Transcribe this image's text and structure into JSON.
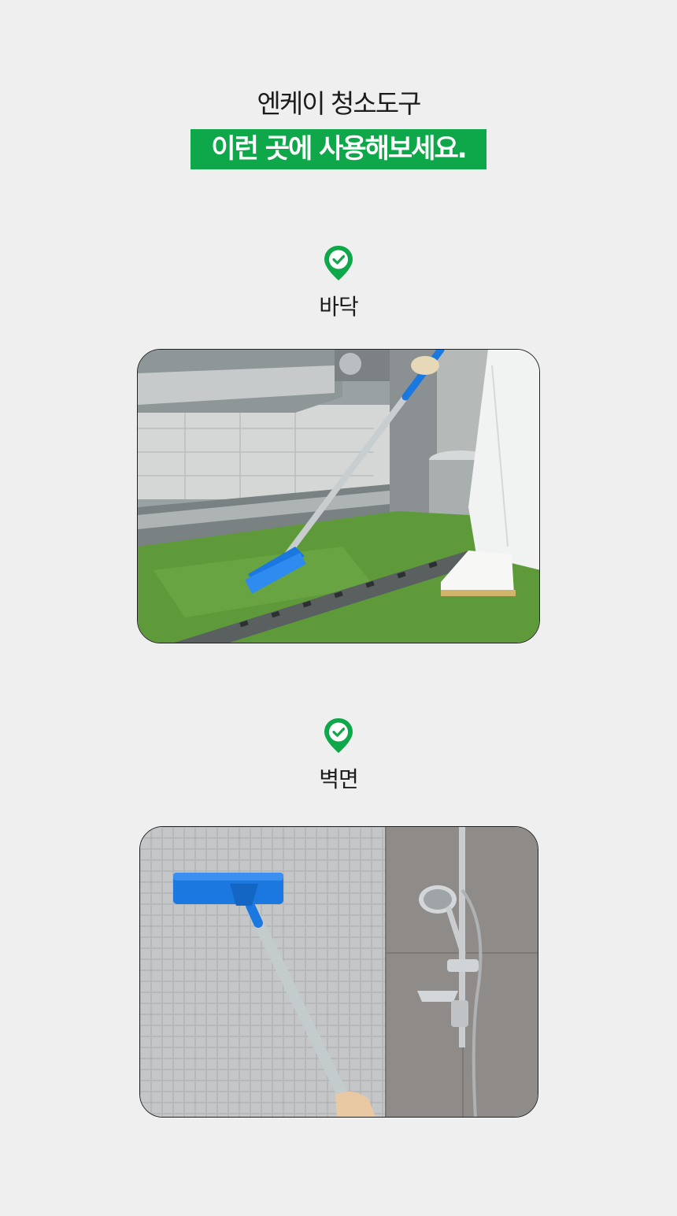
{
  "header": {
    "subtitle": "엔케이 청소도구",
    "headline": "이런 곳에 사용해보세요."
  },
  "sections": [
    {
      "label": "바닥",
      "icon": "location-check-icon",
      "image": "floor-cleaning-photo"
    },
    {
      "label": "벽면",
      "icon": "location-check-icon",
      "image": "wall-cleaning-photo"
    }
  ],
  "colors": {
    "accent": "#0ea84a",
    "background": "#efefef",
    "brush_blue": "#1a78e0"
  }
}
